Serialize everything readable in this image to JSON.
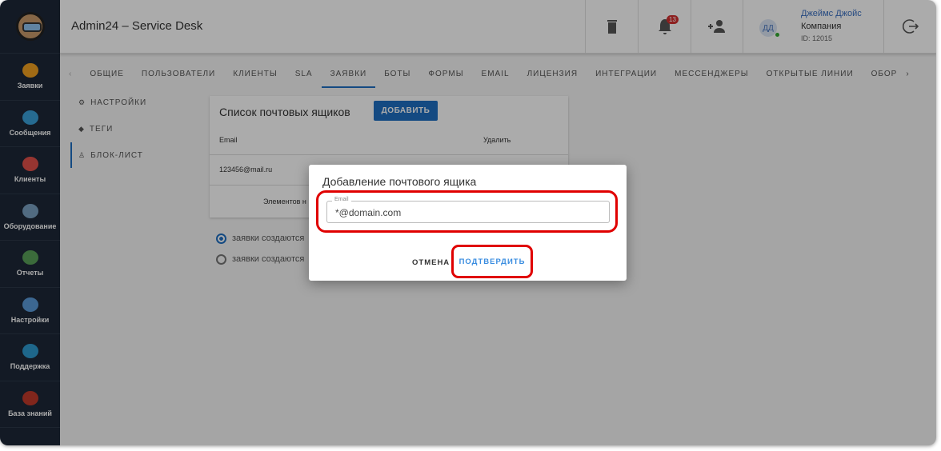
{
  "app": {
    "title": "Admin24 – Service Desk"
  },
  "sidebar": {
    "items": [
      {
        "label": "Заявки",
        "color": "#f0a020"
      },
      {
        "label": "Сообщения",
        "color": "#3aa0d8"
      },
      {
        "label": "Клиенты",
        "color": "#e0504a"
      },
      {
        "label": "Оборудование",
        "color": "#7aa0c0"
      },
      {
        "label": "Отчеты",
        "color": "#58a058"
      },
      {
        "label": "Настройки",
        "color": "#5a9ad8"
      },
      {
        "label": "Поддержка",
        "color": "#2e9ad0"
      },
      {
        "label": "База знаний",
        "color": "#c0392b"
      }
    ]
  },
  "header": {
    "notifications": "13",
    "user": {
      "initials": "ДД",
      "name": "Джеймс Джойс",
      "company": "Компания",
      "id": "ID: 12015"
    }
  },
  "tabs": [
    "ОБЩИЕ",
    "ПОЛЬЗОВАТЕЛИ",
    "КЛИЕНТЫ",
    "SLA",
    "ЗАЯВКИ",
    "БОТЫ",
    "ФОРМЫ",
    "EMAIL",
    "ЛИЦЕНЗИЯ",
    "ИНТЕГРАЦИИ",
    "МЕССЕНДЖЕРЫ",
    "ОТКРЫТЫЕ ЛИНИИ",
    "ОБОР"
  ],
  "subnav": [
    "НАСТРОЙКИ",
    "ТЕГИ",
    "БЛОК-ЛИСТ"
  ],
  "card": {
    "title": "Список почтовых ящиков",
    "add": "ДОБАВИТЬ",
    "col_email": "Email",
    "col_delete": "Удалить",
    "rows": [
      "123456@mail.ru"
    ],
    "footer": "Элементов н"
  },
  "radios": [
    "заявки создаются",
    "заявки создаются"
  ],
  "dialog": {
    "title": "Добавление почтового ящика",
    "field_label": "Email",
    "field_value": "*@domain.com",
    "cancel": "ОТМЕНА",
    "confirm": "ПОДТВЕРДИТЬ"
  },
  "colors": {
    "accent": "#1e6fc2",
    "highlight": "#e00000"
  }
}
